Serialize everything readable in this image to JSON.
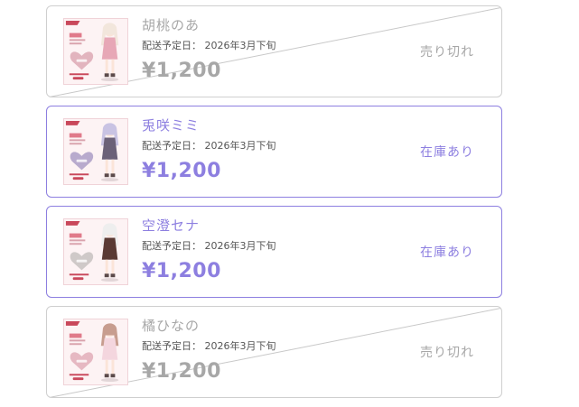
{
  "items": [
    {
      "name": "胡桃のあ",
      "shipping": "配送予定日： 2026年3月下旬",
      "price": "¥1,200",
      "status": "売り切れ",
      "state": "soldout",
      "thumb_icon": "acrylic-stand-product-image",
      "hair_color": "#f2e6dc",
      "outfit_color": "#e7a7b6",
      "heart_color": "#e2b4be"
    },
    {
      "name": "兎咲ミミ",
      "shipping": "配送予定日： 2026年3月下旬",
      "price": "¥1,200",
      "status": "在庫あり",
      "state": "instock",
      "thumb_icon": "acrylic-stand-product-image",
      "hair_color": "#c9c3e3",
      "outfit_color": "#6b6178",
      "heart_color": "#b8aacd"
    },
    {
      "name": "空澄セナ",
      "shipping": "配送予定日： 2026年3月下旬",
      "price": "¥1,200",
      "status": "在庫あり",
      "state": "instock",
      "thumb_icon": "acrylic-stand-product-image",
      "hair_color": "#eeeeee",
      "outfit_color": "#5a3a34",
      "heart_color": "#cfc9c8"
    },
    {
      "name": "橘ひなの",
      "shipping": "配送予定日： 2026年3月下旬",
      "price": "¥1,200",
      "status": "売り切れ",
      "state": "soldout",
      "thumb_icon": "acrylic-stand-product-image",
      "hair_color": "#c79d8f",
      "outfit_color": "#f4d6de",
      "heart_color": "#e6b8c2"
    }
  ]
}
